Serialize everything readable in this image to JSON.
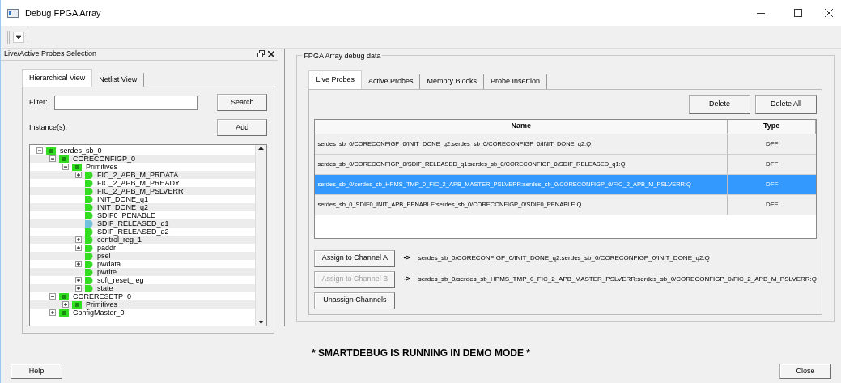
{
  "window": {
    "title": "Debug FPGA Array"
  },
  "left_panel": {
    "title": "Live/Active Probes Selection",
    "tabs": [
      {
        "label": "Hierarchical View",
        "selected": true
      },
      {
        "label": "Netlist View",
        "selected": false
      }
    ],
    "filter": {
      "label": "Filter:"
    },
    "search_button": "Search",
    "instances_label": "Instance(s):",
    "add_button": "Add",
    "tree": [
      {
        "label": "serdes_sb_0",
        "kind": "module",
        "expanded": true,
        "selected": false,
        "children": [
          {
            "label": "CORECONFIGP_0",
            "kind": "module",
            "expanded": true,
            "selected": false,
            "children": [
              {
                "label": "Primitives",
                "kind": "module",
                "expanded": true,
                "selected": false,
                "children": [
                  {
                    "label": "FIC_2_APB_M_PRDATA",
                    "kind": "primitive",
                    "expanded": false,
                    "selected": false
                  },
                  {
                    "label": "FIC_2_APB_M_PREADY",
                    "kind": "primitive",
                    "selected": false
                  },
                  {
                    "label": "FIC_2_APB_M_PSLVERR",
                    "kind": "primitive",
                    "selected": false
                  },
                  {
                    "label": "INIT_DONE_q1",
                    "kind": "primitive",
                    "selected": false
                  },
                  {
                    "label": "INIT_DONE_q2",
                    "kind": "primitive",
                    "selected": false
                  },
                  {
                    "label": "SDIF0_PENABLE",
                    "kind": "primitive",
                    "selected": false
                  },
                  {
                    "label": "SDIF_RELEASED_q1",
                    "kind": "primitive",
                    "selected": true
                  },
                  {
                    "label": "SDIF_RELEASED_q2",
                    "kind": "primitive",
                    "selected": false
                  },
                  {
                    "label": "control_reg_1",
                    "kind": "primitive",
                    "expanded": false,
                    "selected": false
                  },
                  {
                    "label": "paddr",
                    "kind": "primitive",
                    "expanded": false,
                    "selected": false
                  },
                  {
                    "label": "psel",
                    "kind": "primitive",
                    "selected": false
                  },
                  {
                    "label": "pwdata",
                    "kind": "primitive",
                    "expanded": false,
                    "selected": false
                  },
                  {
                    "label": "pwrite",
                    "kind": "primitive",
                    "selected": false
                  },
                  {
                    "label": "soft_reset_reg",
                    "kind": "primitive",
                    "expanded": false,
                    "selected": false
                  },
                  {
                    "label": "state",
                    "kind": "primitive",
                    "expanded": false,
                    "selected": false
                  }
                ]
              }
            ]
          },
          {
            "label": "CORERESETP_0",
            "kind": "module",
            "expanded": true,
            "selected": false,
            "children": [
              {
                "label": "Primitives",
                "kind": "module",
                "expanded": false,
                "selected": false
              }
            ]
          },
          {
            "label": "ConfigMaster_0",
            "kind": "module",
            "expanded": false,
            "selected": false
          }
        ]
      }
    ]
  },
  "right_panel": {
    "title": "FPGA Array debug data",
    "tabs": [
      {
        "label": "Live Probes",
        "selected": true
      },
      {
        "label": "Active Probes",
        "selected": false
      },
      {
        "label": "Memory Blocks",
        "selected": false
      },
      {
        "label": "Probe Insertion",
        "selected": false
      }
    ],
    "buttons": [
      "Delete",
      "Delete All"
    ],
    "table": {
      "columns": [
        "Name",
        "Type"
      ],
      "rows": [
        {
          "name": "serdes_sb_0/CORECONFIGP_0/INIT_DONE_q2:serdes_sb_0/CORECONFIGP_0/INIT_DONE_q2:Q",
          "type": "DFF",
          "selected": false
        },
        {
          "name": "serdes_sb_0/CORECONFIGP_0/SDIF_RELEASED_q1:serdes_sb_0/CORECONFIGP_0/SDIF_RELEASED_q1:Q",
          "type": "DFF",
          "selected": false
        },
        {
          "name": "serdes_sb_0/serdes_sb_HPMS_TMP_0_FIC_2_APB_MASTER_PSLVERR:serdes_sb_0/CORECONFIGP_0/FIC_2_APB_M_PSLVERR:Q",
          "type": "DFF",
          "selected": true
        },
        {
          "name": "serdes_sb_0_SDIF0_INIT_APB_PENABLE:serdes_sb_0/CORECONFIGP_0/SDIF0_PENABLE:Q",
          "type": "DFF",
          "selected": false
        }
      ]
    },
    "channels": [
      {
        "button": "Assign to Channel A",
        "disabled": false,
        "arrow": "->",
        "probe": "serdes_sb_0/CORECONFIGP_0/INIT_DONE_q2:serdes_sb_0/CORECONFIGP_0/INIT_DONE_q2:Q"
      },
      {
        "button": "Assign to Channel B",
        "disabled": true,
        "arrow": "->",
        "probe": "serdes_sb_0/serdes_sb_HPMS_TMP_0_FIC_2_APB_MASTER_PSLVERR:serdes_sb_0/CORECONFIGP_0/FIC_2_APB_M_PSLVERR:Q"
      }
    ],
    "unassign_button": "Unassign Channels"
  },
  "demo_notice": "* SMARTDEBUG IS RUNNING IN DEMO MODE *",
  "footer": {
    "help_button": "Help",
    "close_button": "Close"
  }
}
